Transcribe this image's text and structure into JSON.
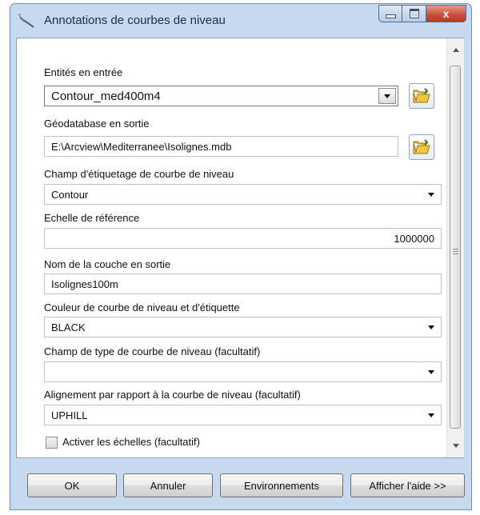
{
  "window": {
    "title": "Annotations de courbes de niveau",
    "controls": {
      "close_label": "x"
    }
  },
  "form": {
    "input_features": {
      "label": "Entités en entrée",
      "value": "Contour_med400m4"
    },
    "output_gdb": {
      "label": "Géodatabase en sortie",
      "value": "E:\\Arcview\\Mediterranee\\Isolignes.mdb"
    },
    "label_field": {
      "label": "Champ d'étiquetage de courbe de niveau",
      "value": "Contour"
    },
    "reference_scale": {
      "label": "Echelle de référence",
      "value": "1000000"
    },
    "output_layer": {
      "label": "Nom de la couche en sortie",
      "value": "Isolignes100m"
    },
    "color": {
      "label": "Couleur de courbe de niveau et d'étiquette",
      "value": "BLACK"
    },
    "type_field": {
      "label": "Champ de type de courbe de niveau (facultatif)",
      "value": ""
    },
    "alignment": {
      "label": "Alignement par rapport à la courbe de niveau (facultatif)",
      "value": "UPHILL"
    },
    "enable_scales": {
      "label": "Activer les échelles (facultatif)",
      "checked": false
    }
  },
  "buttons": {
    "ok": "OK",
    "cancel": "Annuler",
    "environments": "Environnements",
    "help": "Afficher l'aide >>"
  },
  "colors": {
    "frame": "#c6d9ef",
    "close": "#c9503a"
  },
  "icons": [
    "tool-icon",
    "folder-icon",
    "chevron-down-icon"
  ]
}
